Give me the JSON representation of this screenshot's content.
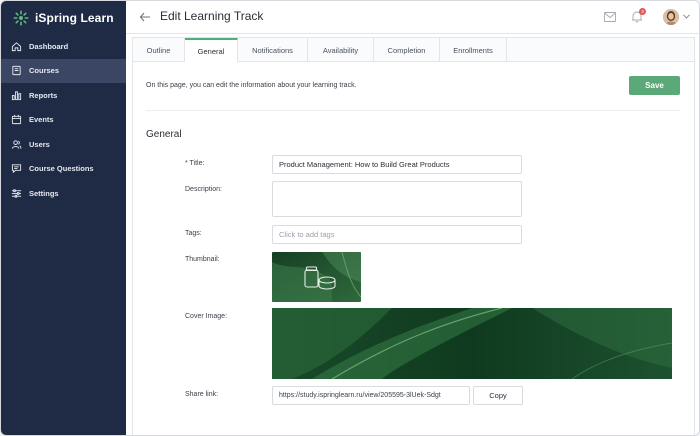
{
  "app": {
    "name": "iSpring Learn",
    "accent": "#4caf73",
    "sidebar_bg": "#1f2a44"
  },
  "sidebar": {
    "items": [
      {
        "label": "Dashboard",
        "icon": "home-icon"
      },
      {
        "label": "Courses",
        "icon": "book-icon",
        "active": true
      },
      {
        "label": "Reports",
        "icon": "bar-chart-icon"
      },
      {
        "label": "Events",
        "icon": "calendar-icon"
      },
      {
        "label": "Users",
        "icon": "users-icon"
      },
      {
        "label": "Course Questions",
        "icon": "chat-icon"
      },
      {
        "label": "Settings",
        "icon": "sliders-icon"
      }
    ]
  },
  "header": {
    "title": "Edit Learning Track",
    "notification_count": "3"
  },
  "tabs": [
    {
      "label": "Outline"
    },
    {
      "label": "General",
      "active": true
    },
    {
      "label": "Notifications"
    },
    {
      "label": "Availability"
    },
    {
      "label": "Completion"
    },
    {
      "label": "Enrollments"
    }
  ],
  "page": {
    "info_text": "On this page, you can edit the information about your learning track.",
    "save_label": "Save",
    "section_title": "General"
  },
  "form": {
    "title_label": "* Title:",
    "title_value": "Product Management: How to Build Great Products",
    "description_label": "Description:",
    "description_value": "",
    "tags_label": "Tags:",
    "tags_placeholder": "Click to add tags",
    "thumbnail_label": "Thumbnail:",
    "cover_label": "Cover Image:",
    "share_label": "Share link:",
    "share_value": "https://study.ispringlearn.ru/view/205595-3lUek-Sdgt",
    "copy_label": "Copy"
  }
}
